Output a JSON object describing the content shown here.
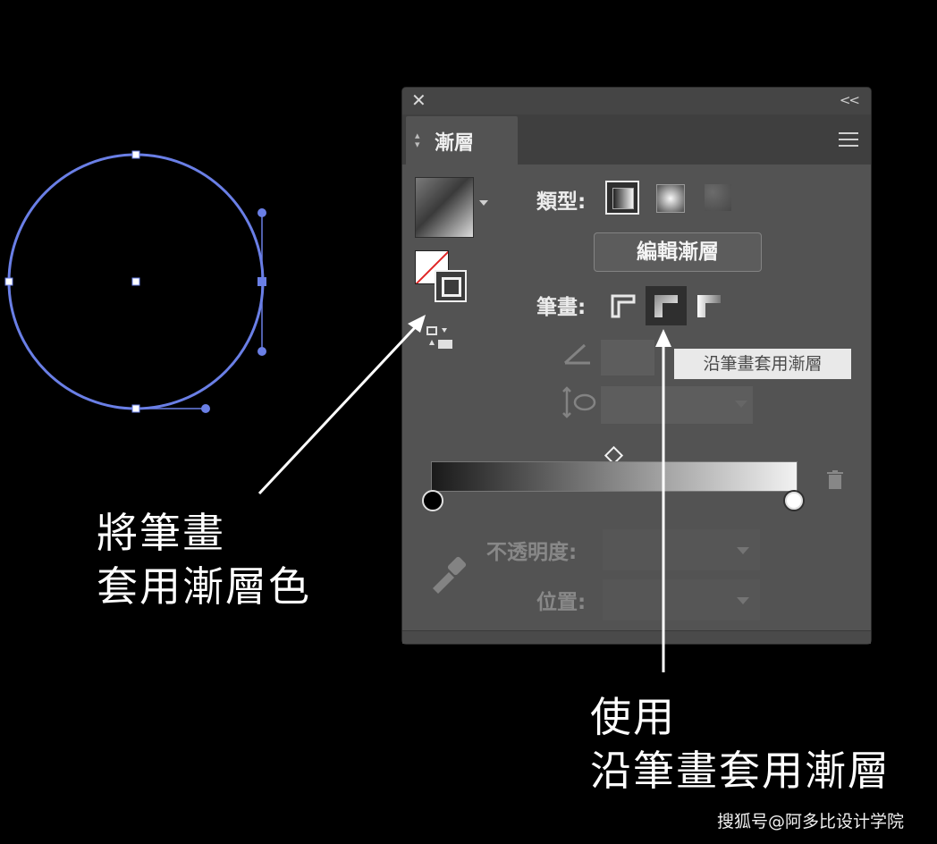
{
  "canvas": {
    "circle_color": "#6a7fe6"
  },
  "panel": {
    "close_icon": "close-icon",
    "collapse_label": "<<",
    "tab_title": "漸層",
    "menu_icon": "hamburger-menu-icon",
    "type_label": "類型:",
    "type_options": [
      "linear-gradient-icon",
      "radial-gradient-icon",
      "freeform-gradient-icon"
    ],
    "edit_gradient_label": "編輯漸層",
    "stroke_label": "筆畫:",
    "stroke_options": [
      "apply-gradient-within-stroke-icon",
      "apply-gradient-along-stroke-icon",
      "apply-gradient-across-stroke-icon"
    ],
    "tooltip": "沿筆畫套用漸層",
    "opacity_label": "不透明度:",
    "position_label": "位置:",
    "gradient_start_color": "#000000",
    "gradient_end_color": "#ffffff"
  },
  "annotations": {
    "left_line1": "將筆畫",
    "left_line2": "套用漸層色",
    "right_line1": "使用",
    "right_line2": "沿筆畫套用漸層"
  },
  "watermark": "搜狐号@阿多比设计学院"
}
